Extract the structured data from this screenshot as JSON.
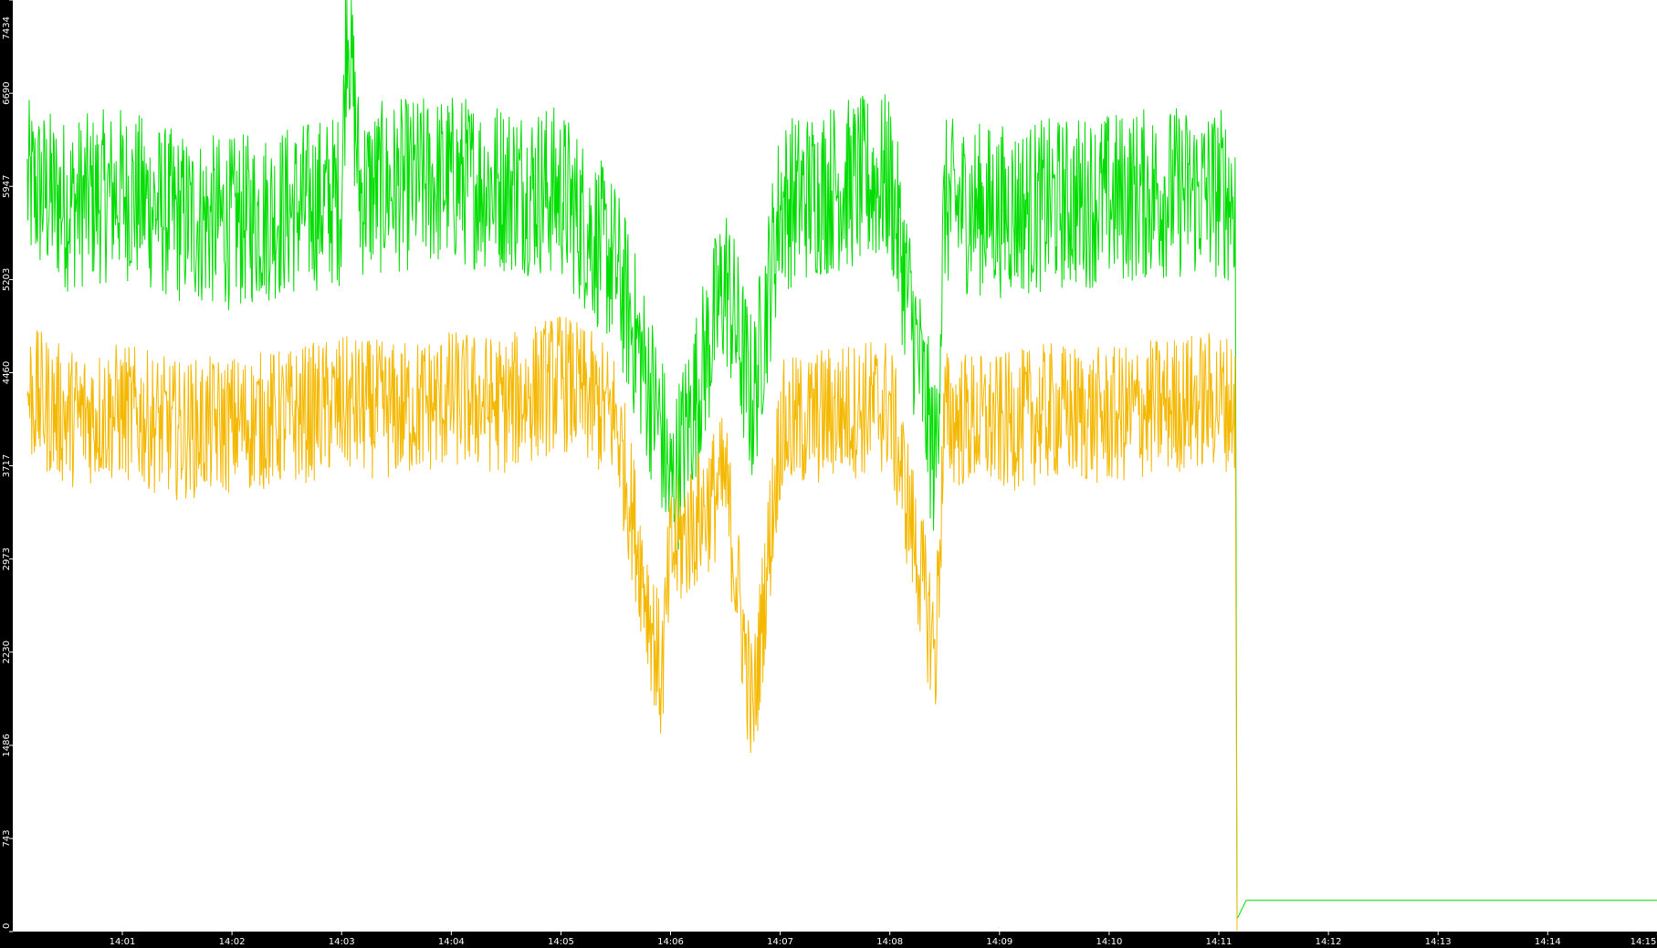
{
  "colors": {
    "background": "#ffffff",
    "axis_band": "#000000",
    "axis_text": "#ffffff",
    "series_green": "#00dd00",
    "series_amber": "#f5b800"
  },
  "chart_data": {
    "type": "line",
    "title": "",
    "xlabel": "",
    "ylabel": "",
    "ylim": [
      0,
      7434
    ],
    "xlim": [
      "14:00:08",
      "14:15:00"
    ],
    "grid": false,
    "legend": "none",
    "y_ticks": [
      "0",
      "743",
      "1486",
      "2230",
      "2973",
      "3717",
      "4460",
      "5203",
      "5947",
      "6690",
      "7434"
    ],
    "x_ticks": [
      "14:01",
      "14:02",
      "14:03",
      "14:04",
      "14:05",
      "14:06",
      "14:07",
      "14:08",
      "14:09",
      "14:10",
      "14:11",
      "14:12",
      "14:13",
      "14:14",
      "14:15"
    ],
    "series": [
      {
        "color": "#00dd00",
        "x": [
          "14:00:08",
          "14:00:30",
          "14:01:00",
          "14:01:30",
          "14:02:00",
          "14:02:30",
          "14:03:00",
          "14:03:03",
          "14:03:10",
          "14:03:30",
          "14:04:00",
          "14:04:30",
          "14:05:00",
          "14:05:30",
          "14:05:55",
          "14:06:00",
          "14:06:30",
          "14:06:45",
          "14:07:00",
          "14:07:30",
          "14:08:00",
          "14:08:25",
          "14:08:30",
          "14:09:00",
          "14:09:30",
          "14:10:00",
          "14:10:30",
          "14:11:00",
          "14:11:09",
          "14:11:10",
          "14:11:15",
          "14:12:00",
          "14:13:00",
          "14:14:00",
          "14:15:00"
        ],
        "y": [
          5950,
          5800,
          5900,
          5700,
          5650,
          5750,
          5850,
          7434,
          5900,
          5950,
          6000,
          5950,
          5900,
          5300,
          4000,
          3500,
          5200,
          4200,
          5800,
          5950,
          6000,
          3700,
          5800,
          5750,
          5800,
          5850,
          5900,
          5900,
          5850,
          100,
          250,
          250,
          250,
          250,
          250
        ]
      },
      {
        "color": "#f5b800",
        "x": [
          "14:00:08",
          "14:00:30",
          "14:01:00",
          "14:01:30",
          "14:02:00",
          "14:02:30",
          "14:03:00",
          "14:03:30",
          "14:04:00",
          "14:04:30",
          "14:05:00",
          "14:05:30",
          "14:05:55",
          "14:06:00",
          "14:06:30",
          "14:06:45",
          "14:07:00",
          "14:07:30",
          "14:08:00",
          "14:08:25",
          "14:08:30",
          "14:09:00",
          "14:09:30",
          "14:10:00",
          "14:10:30",
          "14:11:00",
          "14:11:09",
          "14:11:10"
        ],
        "y": [
          4300,
          4100,
          4150,
          4000,
          4050,
          4100,
          4200,
          4150,
          4250,
          4200,
          4400,
          4100,
          2000,
          3000,
          3600,
          1700,
          4000,
          4150,
          4200,
          2200,
          4100,
          4050,
          4150,
          4100,
          4200,
          4250,
          4200,
          0
        ]
      }
    ]
  }
}
